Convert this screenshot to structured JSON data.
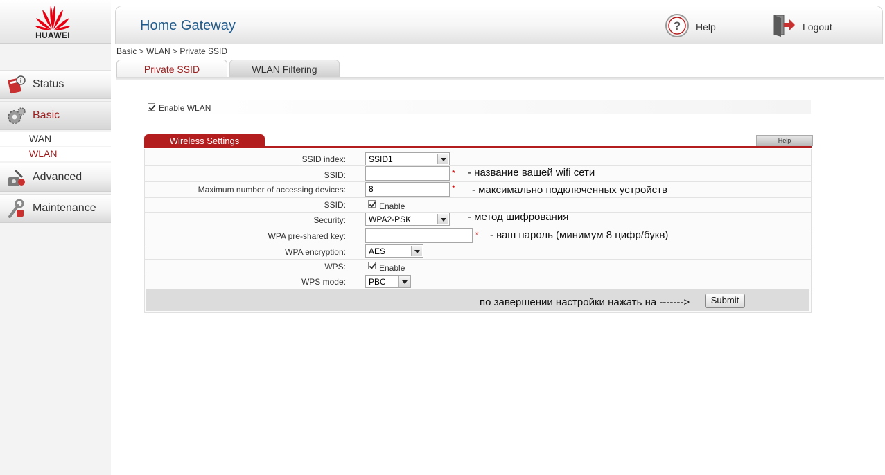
{
  "brand": {
    "logo_text": "HUAWEI",
    "accent": "#b31d1d",
    "title_color": "#1f5a8a"
  },
  "header": {
    "title": "Home Gateway",
    "help_label": "Help",
    "logout_label": "Logout"
  },
  "sidebar": {
    "items": [
      {
        "label": "Status",
        "icon": "status-icon"
      },
      {
        "label": "Basic",
        "icon": "gear-icon"
      },
      {
        "label": "Advanced",
        "icon": "advanced-icon"
      },
      {
        "label": "Maintenance",
        "icon": "maintenance-icon"
      }
    ],
    "sub_items": [
      {
        "label": "WAN"
      },
      {
        "label": "WLAN"
      }
    ]
  },
  "breadcrumb": "Basic > WLAN > Private SSID",
  "tabs": [
    {
      "label": "Private SSID",
      "active": true
    },
    {
      "label": "WLAN Filtering",
      "active": false
    }
  ],
  "enable_wlan": {
    "label": "Enable WLAN",
    "checked": true
  },
  "wireless_settings": {
    "title": "Wireless Settings",
    "help_label": "Help",
    "fields": {
      "ssid_index": {
        "label": "SSID index:",
        "value": "SSID1"
      },
      "ssid": {
        "label": "SSID:",
        "value": "",
        "required": "*",
        "note": "- название вашей wifi сети"
      },
      "max_devices": {
        "label": "Maximum number of accessing devices:",
        "value": "8",
        "required": "*",
        "note": "- максимально подключенных устройств"
      },
      "ssid_enable": {
        "label": "SSID:",
        "checkbox_label": "Enable",
        "checked": true
      },
      "security": {
        "label": "Security:",
        "value": "WPA2-PSK",
        "note": "- метод шифрования"
      },
      "wpa_key": {
        "label": "WPA pre-shared key:",
        "value": "",
        "required": "*",
        "note": "- ваш пароль (минимум 8 цифр/букв)"
      },
      "wpa_encryption": {
        "label": "WPA encryption:",
        "value": "AES"
      },
      "wps": {
        "label": "WPS:",
        "checkbox_label": "Enable",
        "checked": true
      },
      "wps_mode": {
        "label": "WPS mode:",
        "value": "PBC"
      }
    },
    "submit_note": "по завершении настройки нажать на ------->",
    "submit_label": "Submit"
  }
}
